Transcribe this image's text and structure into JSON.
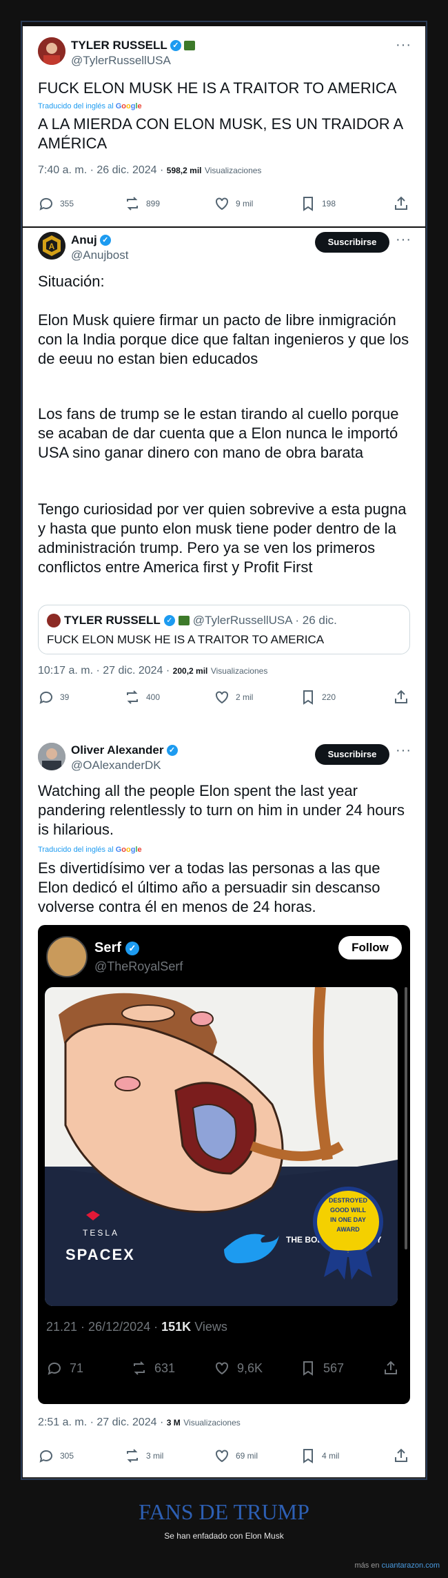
{
  "tweet1": {
    "name": "TYLER RUSSELL",
    "handle": "@TylerRussellUSA",
    "text": "FUCK ELON MUSK HE IS A TRAITOR TO AMERICA",
    "translated_label": "Traducido del inglés al",
    "translation": "A LA MIERDA CON ELON MUSK, ES UN TRAIDOR A AMÉRICA",
    "time": "7:40 a. m. · 26 dic. 2024 ·",
    "views_count": "598,2 mil",
    "views_label": "Visualizaciones",
    "replies": "355",
    "reposts": "899",
    "likes": "9 mil",
    "bookmarks": "198"
  },
  "tweet2": {
    "name": "Anuj",
    "handle": "@Anujbost",
    "subscribe": "Suscribirse",
    "para1": "Situación:",
    "para2": "Elon Musk quiere firmar un pacto de libre inmigración con la India porque dice que faltan ingenieros y que los de eeuu no estan bien educados",
    "para3": "Los fans de trump se le estan tirando al cuello porque se acaban de dar cuenta que a Elon nunca le importó USA sino ganar dinero con mano de obra barata",
    "para4": "Tengo curiosidad por ver quien sobrevive a esta pugna y hasta que punto elon musk tiene poder dentro de la administración trump. Pero ya se ven los primeros conflictos entre America first y Profit First",
    "quote_name": "TYLER RUSSELL",
    "quote_meta": "@TylerRussellUSA · 26 dic.",
    "quote_text": "FUCK ELON MUSK HE IS A TRAITOR TO AMERICA",
    "time": "10:17 a. m. · 27 dic. 2024 ·",
    "views_count": "200,2 mil",
    "views_label": "Visualizaciones",
    "replies": "39",
    "reposts": "400",
    "likes": "2 mil",
    "bookmarks": "220"
  },
  "tweet3": {
    "name": "Oliver Alexander",
    "handle": "@OAlexanderDK",
    "subscribe": "Suscribirse",
    "text": "Watching all the people Elon spent the last year pandering relentlessly to turn on him in under 24 hours is hilarious.",
    "translated_label": "Traducido del inglés al",
    "translation": "Es divertidísimo ver a todas las personas a las que Elon dedicó el último año a persuadir sin descanso volverse contra él en menos de 24 horas.",
    "embed": {
      "name": "Serf",
      "handle": "@TheRoyalSerf",
      "follow": "Follow",
      "time": "21.21 · 26/12/2024 ·",
      "views_count": "151K",
      "views_label": "Views",
      "replies": "71",
      "reposts": "631",
      "likes": "9,6K",
      "bookmarks": "567",
      "badge_text": "DESTROYED GOOD WILL IN ONE DAY AWARD",
      "tesla_text": "TESLA",
      "spacex_text": "SPACEX",
      "boeing_text": "THE BOEING COMPANY"
    },
    "time": "2:51 a. m. · 27 dic. 2024 ·",
    "views_count": "3 M",
    "views_label": "Visualizaciones",
    "replies": "305",
    "reposts": "3 mil",
    "likes": "69 mil",
    "bookmarks": "4 mil"
  },
  "google_word": "Google",
  "footer": {
    "title": "FANS DE TRUMP",
    "subtitle": "Se han enfadado con Elon Musk",
    "more_prefix": "más en",
    "more_site": "cuantarazon.com"
  }
}
